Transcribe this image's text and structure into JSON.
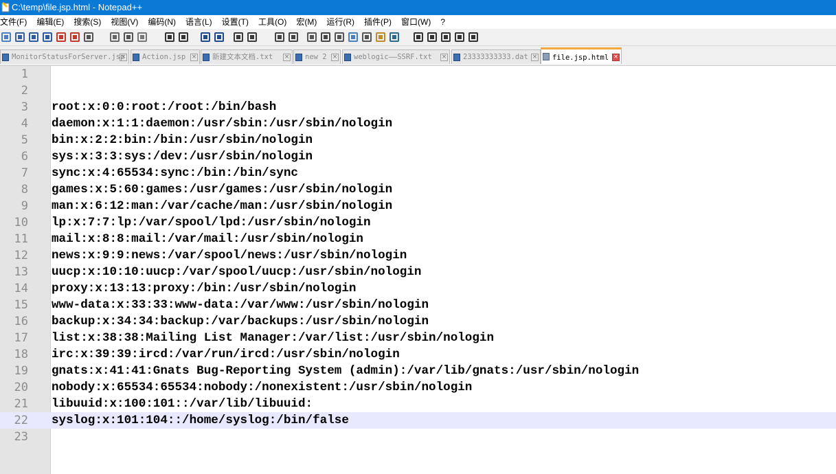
{
  "window": {
    "title": "C:\\temp\\file.jsp.html - Notepad++"
  },
  "menu": [
    "文件(F)",
    "编辑(E)",
    "搜索(S)",
    "视图(V)",
    "编码(N)",
    "语言(L)",
    "设置(T)",
    "工具(O)",
    "宏(M)",
    "运行(R)",
    "插件(P)",
    "窗口(W)",
    "?"
  ],
  "toolbar_icons": [
    "new-file-icon",
    "open-file-icon",
    "save-icon",
    "save-all-icon",
    "close-icon",
    "close-all-icon",
    "print-icon",
    "cut-icon",
    "copy-icon",
    "paste-icon",
    "undo-icon",
    "redo-icon",
    "find-icon",
    "replace-icon",
    "zoom-in-icon",
    "zoom-out-icon",
    "sync-vertical-icon",
    "sync-horizontal-icon",
    "word-wrap-icon",
    "show-all-characters-icon",
    "indent-guide-icon",
    "document-map-icon",
    "function-list-icon",
    "folder-as-workspace-icon",
    "monitoring-icon",
    "record-macro-icon",
    "stop-recording-icon",
    "playback-macro-icon",
    "run-macro-multiple-icon",
    "save-macro-icon"
  ],
  "tabs": [
    {
      "label": "MonitorStatusForServer.jsp",
      "active": false
    },
    {
      "label": "Action.jsp",
      "active": false
    },
    {
      "label": "新建文本文档.txt",
      "active": false
    },
    {
      "label": "new 2",
      "active": false
    },
    {
      "label": "weblogic——SSRF.txt",
      "active": false
    },
    {
      "label": "23333333333.dat",
      "active": false
    },
    {
      "label": "file.jsp.html",
      "active": true
    }
  ],
  "editor": {
    "current_line": 22,
    "lines": [
      "",
      "",
      "root:x:0:0:root:/root:/bin/bash",
      "daemon:x:1:1:daemon:/usr/sbin:/usr/sbin/nologin",
      "bin:x:2:2:bin:/bin:/usr/sbin/nologin",
      "sys:x:3:3:sys:/dev:/usr/sbin/nologin",
      "sync:x:4:65534:sync:/bin:/bin/sync",
      "games:x:5:60:games:/usr/games:/usr/sbin/nologin",
      "man:x:6:12:man:/var/cache/man:/usr/sbin/nologin",
      "lp:x:7:7:lp:/var/spool/lpd:/usr/sbin/nologin",
      "mail:x:8:8:mail:/var/mail:/usr/sbin/nologin",
      "news:x:9:9:news:/var/spool/news:/usr/sbin/nologin",
      "uucp:x:10:10:uucp:/var/spool/uucp:/usr/sbin/nologin",
      "proxy:x:13:13:proxy:/bin:/usr/sbin/nologin",
      "www-data:x:33:33:www-data:/var/www:/usr/sbin/nologin",
      "backup:x:34:34:backup:/var/backups:/usr/sbin/nologin",
      "list:x:38:38:Mailing List Manager:/var/list:/usr/sbin/nologin",
      "irc:x:39:39:ircd:/var/run/ircd:/usr/sbin/nologin",
      "gnats:x:41:41:Gnats Bug-Reporting System (admin):/var/lib/gnats:/usr/sbin/nologin",
      "nobody:x:65534:65534:nobody:/nonexistent:/usr/sbin/nologin",
      "libuuid:x:100:101::/var/lib/libuuid:",
      "syslog:x:101:104::/home/syslog:/bin/false",
      ""
    ]
  }
}
